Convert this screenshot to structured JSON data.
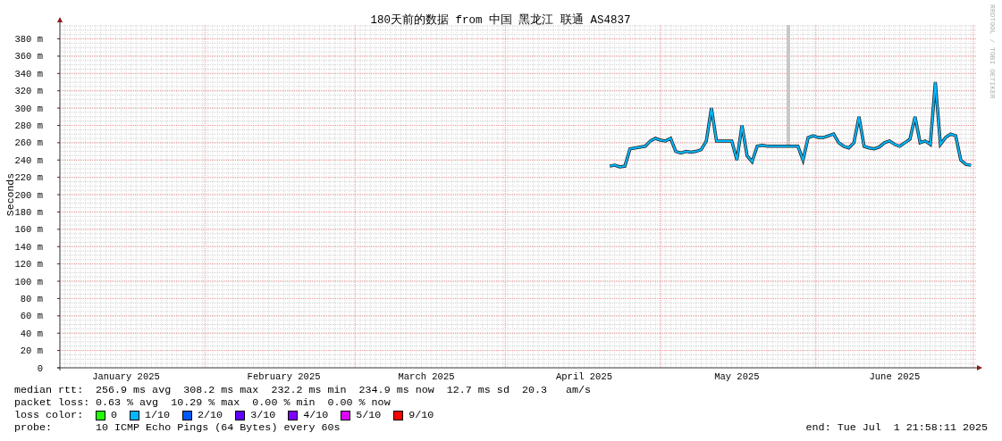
{
  "graph": {
    "watermark": "RRDTOOL / TOBI OETIKER",
    "chart_data": {
      "type": "line",
      "title": "180天前的数据 from 中国 黑龙江 联通 AS4837",
      "ylabel": "Seconds",
      "ylim": [
        0,
        396
      ],
      "grid": true,
      "categories": [
        null,
        null,
        null,
        null,
        null,
        null,
        null,
        null,
        null,
        null,
        null,
        null,
        null,
        "January 2025",
        null,
        null,
        null,
        null,
        null,
        null,
        null,
        null,
        null,
        null,
        null,
        null,
        null,
        null,
        null,
        null,
        null,
        null,
        null,
        null,
        null,
        null,
        null,
        null,
        null,
        null,
        null,
        null,
        null,
        null,
        "February 2025",
        null,
        null,
        null,
        null,
        null,
        null,
        null,
        null,
        null,
        null,
        null,
        null,
        null,
        null,
        null,
        null,
        null,
        null,
        null,
        null,
        null,
        null,
        null,
        null,
        null,
        null,
        null,
        "March 2025",
        null,
        null,
        null,
        null,
        null,
        null,
        null,
        null,
        null,
        null,
        null,
        null,
        null,
        null,
        null,
        null,
        null,
        null,
        null,
        null,
        null,
        null,
        null,
        null,
        null,
        null,
        null,
        null,
        null,
        null,
        "April 2025",
        null,
        null,
        null,
        null,
        null,
        null,
        null,
        null,
        null,
        null,
        null,
        null,
        null,
        null,
        null,
        null,
        null,
        null,
        null,
        null,
        null,
        null,
        null,
        null,
        null,
        null,
        null,
        null,
        null,
        "May 2025",
        null,
        null,
        null,
        null,
        null,
        null,
        null,
        null,
        null,
        null,
        null,
        null,
        null,
        null,
        null,
        null,
        null,
        null,
        null,
        null,
        null,
        null,
        null,
        null,
        null,
        null,
        null,
        null,
        null,
        null,
        "June 2025",
        null,
        null,
        null,
        null,
        null,
        null,
        null,
        null,
        null,
        null,
        null,
        null,
        null,
        null,
        null
      ],
      "yticks": [
        {
          "value": 0,
          "label": "0"
        },
        {
          "value": 20,
          "label": "20 m"
        },
        {
          "value": 40,
          "label": "40 m"
        },
        {
          "value": 60,
          "label": "60 m"
        },
        {
          "value": 80,
          "label": "80 m"
        },
        {
          "value": 100,
          "label": "100 m"
        },
        {
          "value": 120,
          "label": "120 m"
        },
        {
          "value": 140,
          "label": "140 m"
        },
        {
          "value": 160,
          "label": "160 m"
        },
        {
          "value": 180,
          "label": "180 m"
        },
        {
          "value": 200,
          "label": "200 m"
        },
        {
          "value": 220,
          "label": "220 m"
        },
        {
          "value": 240,
          "label": "240 m"
        },
        {
          "value": 260,
          "label": "260 m"
        },
        {
          "value": 280,
          "label": "280 m"
        },
        {
          "value": 300,
          "label": "300 m"
        },
        {
          "value": 320,
          "label": "320 m"
        },
        {
          "value": 340,
          "label": "340 m"
        },
        {
          "value": 360,
          "label": "360 m"
        },
        {
          "value": 380,
          "label": "380 m"
        }
      ],
      "series": [
        {
          "color": "#00b8ff",
          "values": [
            null,
            null,
            null,
            null,
            null,
            null,
            null,
            null,
            null,
            null,
            null,
            null,
            null,
            null,
            null,
            null,
            null,
            null,
            null,
            null,
            null,
            null,
            null,
            null,
            null,
            null,
            null,
            null,
            null,
            null,
            null,
            null,
            null,
            null,
            null,
            null,
            null,
            null,
            null,
            null,
            null,
            null,
            null,
            null,
            null,
            null,
            null,
            null,
            null,
            null,
            null,
            null,
            null,
            null,
            null,
            null,
            null,
            null,
            null,
            null,
            null,
            null,
            null,
            null,
            null,
            null,
            null,
            null,
            null,
            null,
            null,
            null,
            null,
            null,
            null,
            null,
            null,
            null,
            null,
            null,
            null,
            null,
            null,
            null,
            null,
            null,
            null,
            null,
            null,
            null,
            null,
            null,
            null,
            null,
            null,
            null,
            null,
            null,
            null,
            null,
            null,
            null,
            null,
            null,
            null,
            null,
            null,
            null,
            233,
            234,
            232,
            233,
            253,
            254,
            255,
            256,
            262,
            265,
            263,
            262,
            265,
            250,
            248,
            250,
            249,
            250,
            252,
            262,
            300,
            262,
            262,
            262,
            262,
            240,
            280,
            245,
            238,
            256,
            257,
            256,
            256,
            256,
            256,
            256,
            256,
            256,
            240,
            266,
            268,
            266,
            266,
            268,
            270,
            260,
            256,
            254,
            260,
            290,
            256,
            254,
            253,
            255,
            260,
            262,
            258,
            256,
            260,
            264,
            290,
            260,
            262,
            258,
            330,
            258,
            266,
            270,
            268,
            240,
            235,
            234
          ]
        }
      ]
    }
  },
  "legend": {
    "median_rtt": {
      "label": "median rtt:",
      "values": "256.9 ms avg  308.2 ms max  232.2 ms min  234.9 ms now  12.7 ms sd  20.3   am/s"
    },
    "packet_loss": {
      "label": "packet loss:",
      "values": "0.63 % avg  10.29 % max  0.00 % min  0.00 % now"
    },
    "loss_color": {
      "label": "loss color:",
      "items": [
        {
          "label": "0",
          "color": "#26ff00"
        },
        {
          "label": "1/10",
          "color": "#00b8ff"
        },
        {
          "label": "2/10",
          "color": "#0059ff"
        },
        {
          "label": "3/10",
          "color": "#5e00ff"
        },
        {
          "label": "4/10",
          "color": "#7e00ff"
        },
        {
          "label": "5/10",
          "color": "#dd00ff"
        },
        {
          "label": "9/10",
          "color": "#ff0000"
        }
      ]
    },
    "probe": {
      "label": "probe:",
      "value": "10 ICMP Echo Pings (64 Bytes) every 60s"
    },
    "end": "end: Tue Jul  1 21:58:11 2025"
  }
}
